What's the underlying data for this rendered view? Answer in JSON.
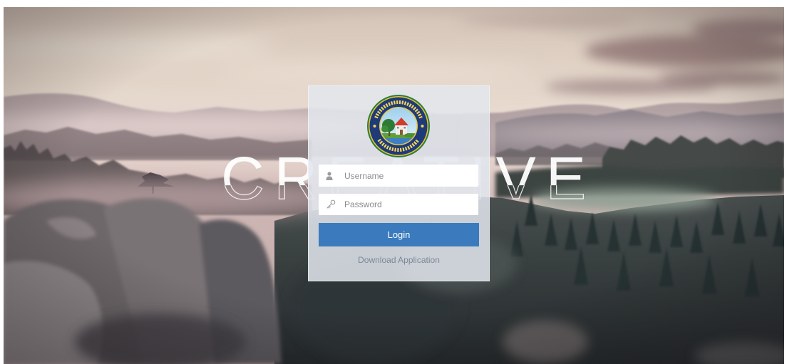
{
  "background": {
    "logo_text": "CREATIVE"
  },
  "login_panel": {
    "logo_icon": "municipality-seal",
    "username": {
      "icon": "user-icon",
      "placeholder": "Username",
      "value": ""
    },
    "password": {
      "icon": "key-icon",
      "placeholder": "Password",
      "value": ""
    },
    "submit_label": "Login",
    "download_label": "Download Application"
  },
  "colors": {
    "panel_background": "#e2e6ee",
    "button": "#3b7bbd",
    "button_text": "#ffffff",
    "link": "#7b8896",
    "placeholder": "#8a8a8a"
  }
}
